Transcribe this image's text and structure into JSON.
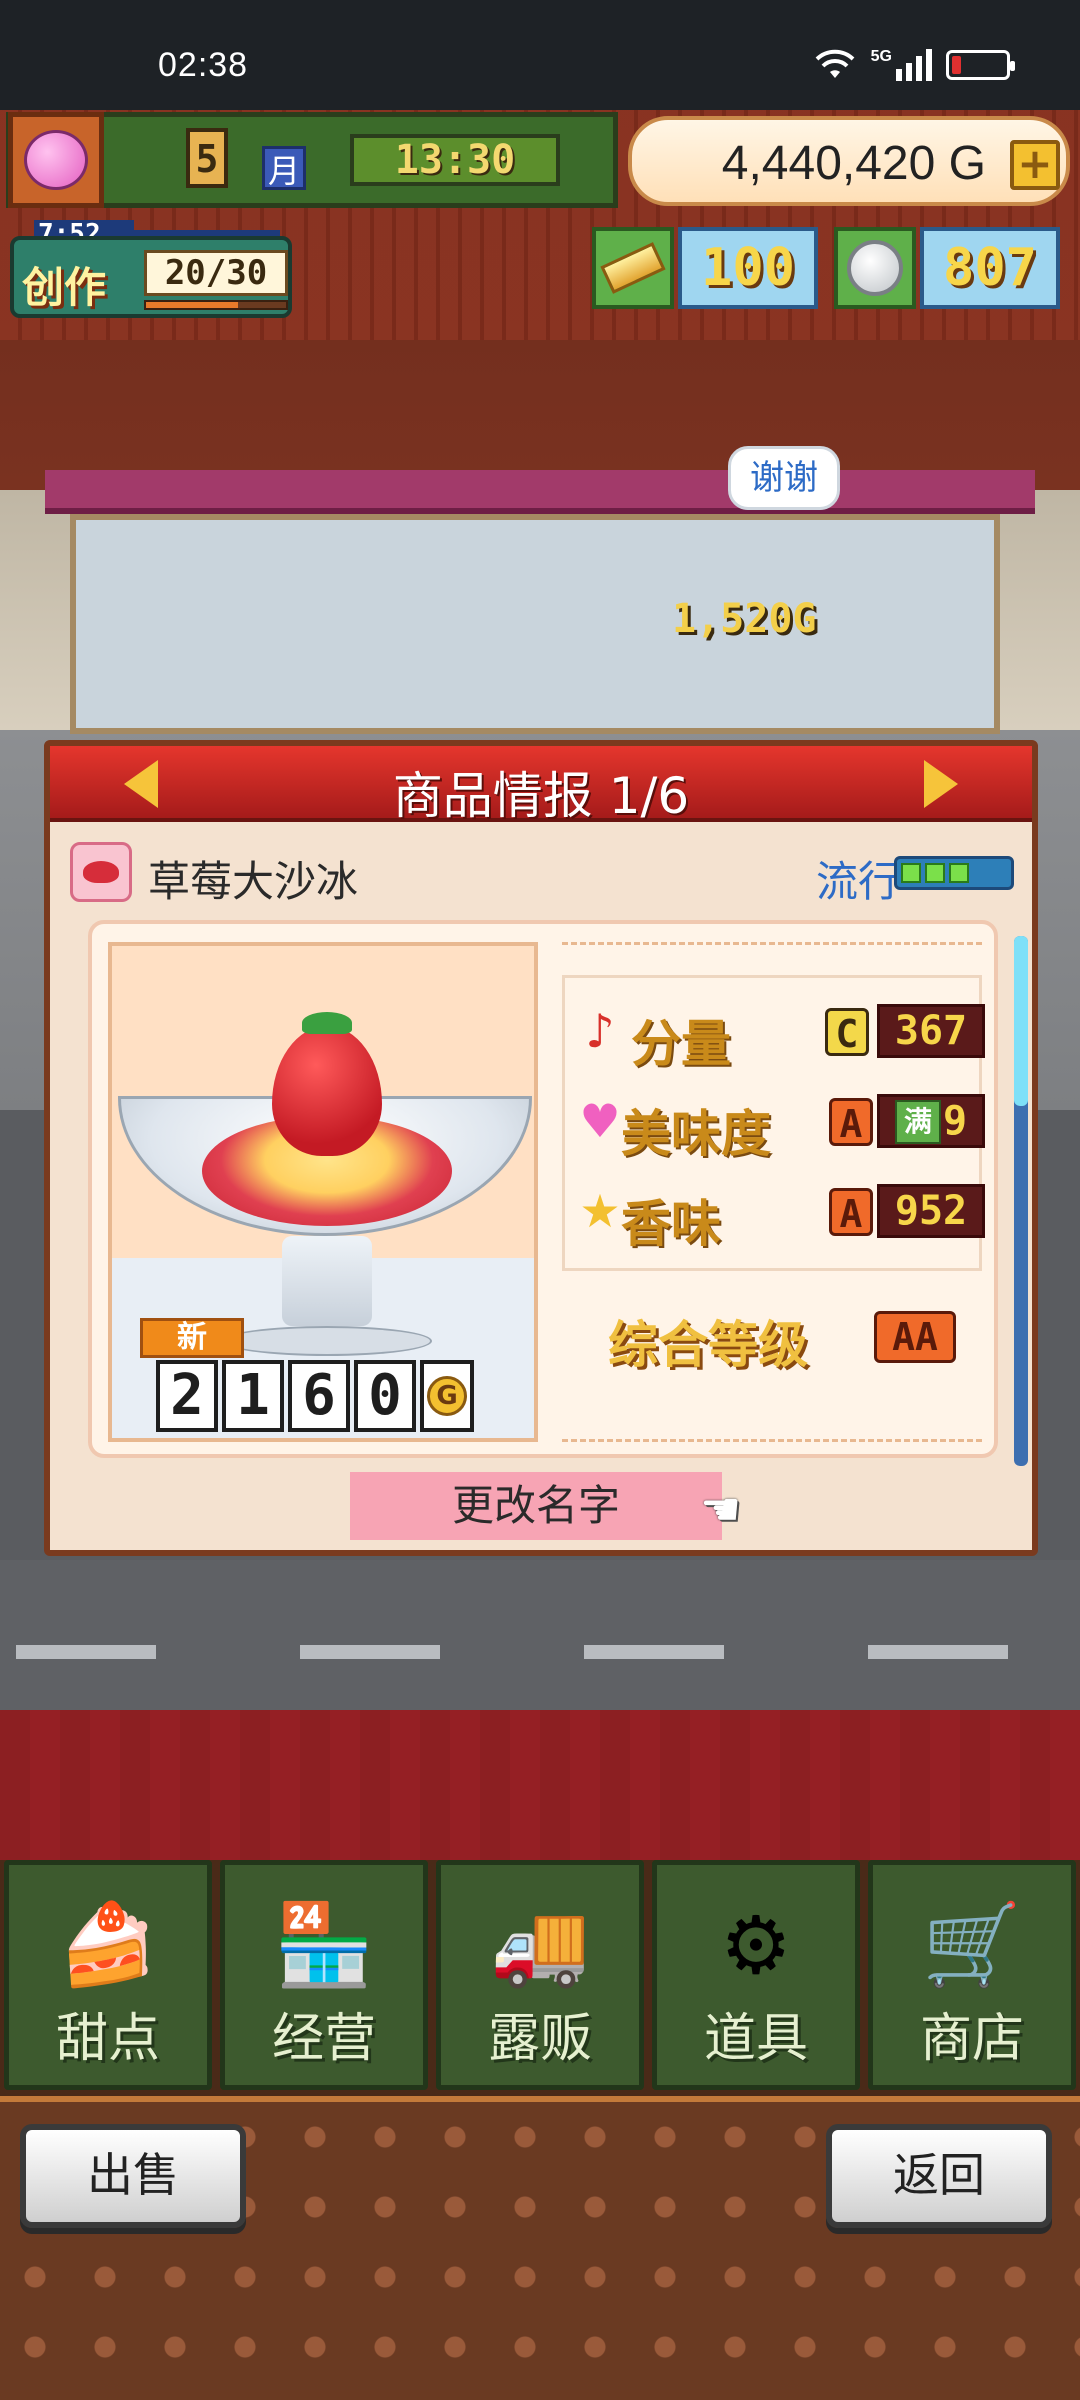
{
  "status_bar": {
    "time": "02:38",
    "network": "5G"
  },
  "hud": {
    "month": "5",
    "month_unit": "月",
    "clock": "13:30",
    "money": "4,440,420",
    "money_unit": "G",
    "add_money": "+",
    "create_timer": "7:52",
    "create_label": "创作",
    "create_count": "20/30",
    "gold_bars": "100",
    "medals": "807"
  },
  "scene": {
    "speech_bubble": "谢谢",
    "floating_price": "1,520G"
  },
  "panel": {
    "title": "商品情报 1/6",
    "item_name": "草莓大沙冰",
    "trend_label": "流行",
    "trend_level": 3,
    "new_tag": "新",
    "price_digits": [
      "2",
      "1",
      "6",
      "0"
    ],
    "price_unit": "G",
    "stats": [
      {
        "name": "分量",
        "icon": "music-note-icon",
        "grade": "C",
        "value": "367"
      },
      {
        "name": "美味度",
        "icon": "heart-icon",
        "grade": "A",
        "value": "999",
        "max_tag": "满"
      },
      {
        "name": "香味",
        "icon": "star-icon",
        "grade": "A",
        "value": "952"
      }
    ],
    "overall_label": "综合等级",
    "overall_grade": "AA",
    "rename_button": "更改名字"
  },
  "menu": [
    {
      "label": "甜点",
      "icon": "cake-icon"
    },
    {
      "label": "经营",
      "icon": "shop-icon"
    },
    {
      "label": "露贩",
      "icon": "food-truck-icon"
    },
    {
      "label": "道具",
      "icon": "tools-bag-icon"
    },
    {
      "label": "商店",
      "icon": "cart-icon"
    }
  ],
  "footer": {
    "sell_button": "出售",
    "back_button": "返回"
  },
  "colors": {
    "panel_header": "#c5221f",
    "trend_text": "#2d6bc6",
    "menu_green": "#3d5a2e"
  }
}
